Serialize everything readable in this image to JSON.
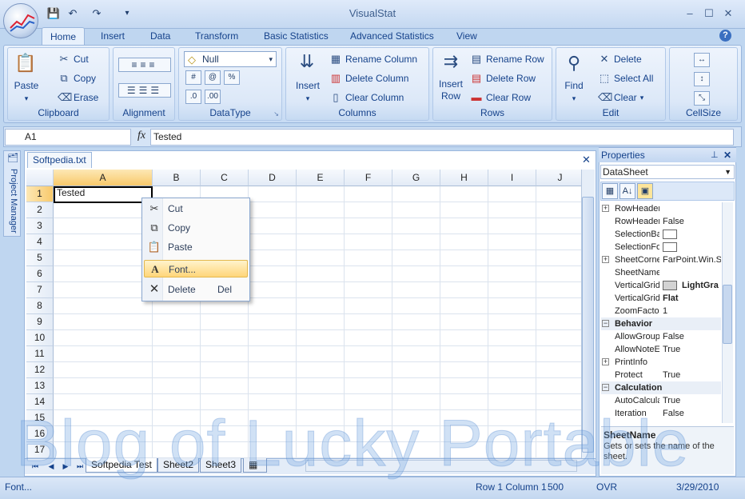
{
  "app": {
    "title": "VisualStat"
  },
  "quick_access": {
    "save_icon": "save-icon",
    "undo_icon": "undo-icon",
    "redo_icon": "redo-icon",
    "customize_icon": "customize-qat-icon"
  },
  "window_buttons": {
    "minimize": "–",
    "maximize": "☐",
    "close": "✕"
  },
  "ribbon_tabs": [
    "Home",
    "Insert",
    "Data",
    "Transform",
    "Basic Statistics",
    "Advanced Statistics",
    "View"
  ],
  "ribbon": {
    "clipboard": {
      "label": "Clipboard",
      "paste": "Paste",
      "cut": "Cut",
      "copy": "Copy",
      "erase": "Erase"
    },
    "alignment": {
      "label": "Alignment"
    },
    "datatype": {
      "label": "DataType",
      "value": "Null",
      "btn_hash": "#",
      "btn_at": "@",
      "btn_pct": "%",
      "btn_dec1": ".0",
      "btn_dec2": ".00"
    },
    "columns": {
      "label": "Columns",
      "insert": "Insert",
      "rename": "Rename Column",
      "delete": "Delete Column",
      "clear": "Clear Column"
    },
    "rows": {
      "label": "Rows",
      "insert1": "Insert",
      "insert2": "Row",
      "rename": "Rename Row",
      "delete": "Delete Row",
      "clear": "Clear Row"
    },
    "edit": {
      "label": "Edit",
      "find": "Find",
      "delete": "Delete",
      "select_all": "Select All",
      "clear": "Clear"
    },
    "cellsize": {
      "label": "CellSize"
    }
  },
  "formula_bar": {
    "cell_ref": "A1",
    "fx": "fx",
    "value": "Tested"
  },
  "side_panel": {
    "label": "Project Manager"
  },
  "document": {
    "tab": "Softpedia.txt",
    "columns": [
      "A",
      "B",
      "C",
      "D",
      "E",
      "F",
      "G",
      "H",
      "I",
      "J"
    ],
    "rows": [
      "1",
      "2",
      "3",
      "4",
      "5",
      "6",
      "7",
      "8",
      "9",
      "10",
      "11",
      "12",
      "13",
      "14",
      "15",
      "16",
      "17"
    ],
    "cell_a1": "Tested",
    "sheets": [
      "Softpedia Test",
      "Sheet2",
      "Sheet3"
    ]
  },
  "context_menu": {
    "items": [
      {
        "label": "Cut",
        "icon": "scissors-icon",
        "shortcut": ""
      },
      {
        "label": "Copy",
        "icon": "copy-icon",
        "shortcut": ""
      },
      {
        "label": "Paste",
        "icon": "paste-icon",
        "shortcut": ""
      },
      {
        "label": "Font...",
        "icon": "font-icon",
        "shortcut": ""
      },
      {
        "label": "Delete",
        "icon": "delete-icon",
        "shortcut": "Del"
      }
    ]
  },
  "properties": {
    "title": "Properties",
    "object": "DataSheet",
    "rows": [
      {
        "name": "RowHeader",
        "value": "",
        "expand": "+"
      },
      {
        "name": "RowHeader",
        "value": "False",
        "expand": ""
      },
      {
        "name": "SelectionBa",
        "value": "",
        "expand": "",
        "swatch": "#ffffff"
      },
      {
        "name": "SelectionFo",
        "value": "",
        "expand": "",
        "swatch": "#ffffff"
      },
      {
        "name": "SheetCorne",
        "value": "FarPoint.Win.Sp",
        "expand": "+"
      },
      {
        "name": "SheetName",
        "value": "",
        "expand": ""
      },
      {
        "name": "VerticalGrid",
        "value": "LightGra",
        "expand": "",
        "swatch": "#d3d3d3"
      },
      {
        "name": "VerticalGrid",
        "value": "Flat",
        "expand": ""
      },
      {
        "name": "ZoomFactor",
        "value": "1",
        "expand": ""
      },
      {
        "name": "Behavior",
        "value": "",
        "expand": "−",
        "category": true
      },
      {
        "name": "AllowGroup",
        "value": "False",
        "expand": ""
      },
      {
        "name": "AllowNoteE",
        "value": "True",
        "expand": ""
      },
      {
        "name": "PrintInfo",
        "value": "",
        "expand": "+"
      },
      {
        "name": "Protect",
        "value": "True",
        "expand": ""
      },
      {
        "name": "Calculation",
        "value": "",
        "expand": "−",
        "category": true
      },
      {
        "name": "AutoCalcula",
        "value": "True",
        "expand": ""
      },
      {
        "name": "Iteration",
        "value": "False",
        "expand": ""
      }
    ],
    "desc_title": "SheetName",
    "desc_text": "Gets or sets the name of the sheet."
  },
  "status": {
    "left": "Font...",
    "position": "Row 1 Column 1",
    "count": "500",
    "mode": "OVR",
    "date": "3/29/2010"
  },
  "watermark": "Blog of Lucky Portable"
}
